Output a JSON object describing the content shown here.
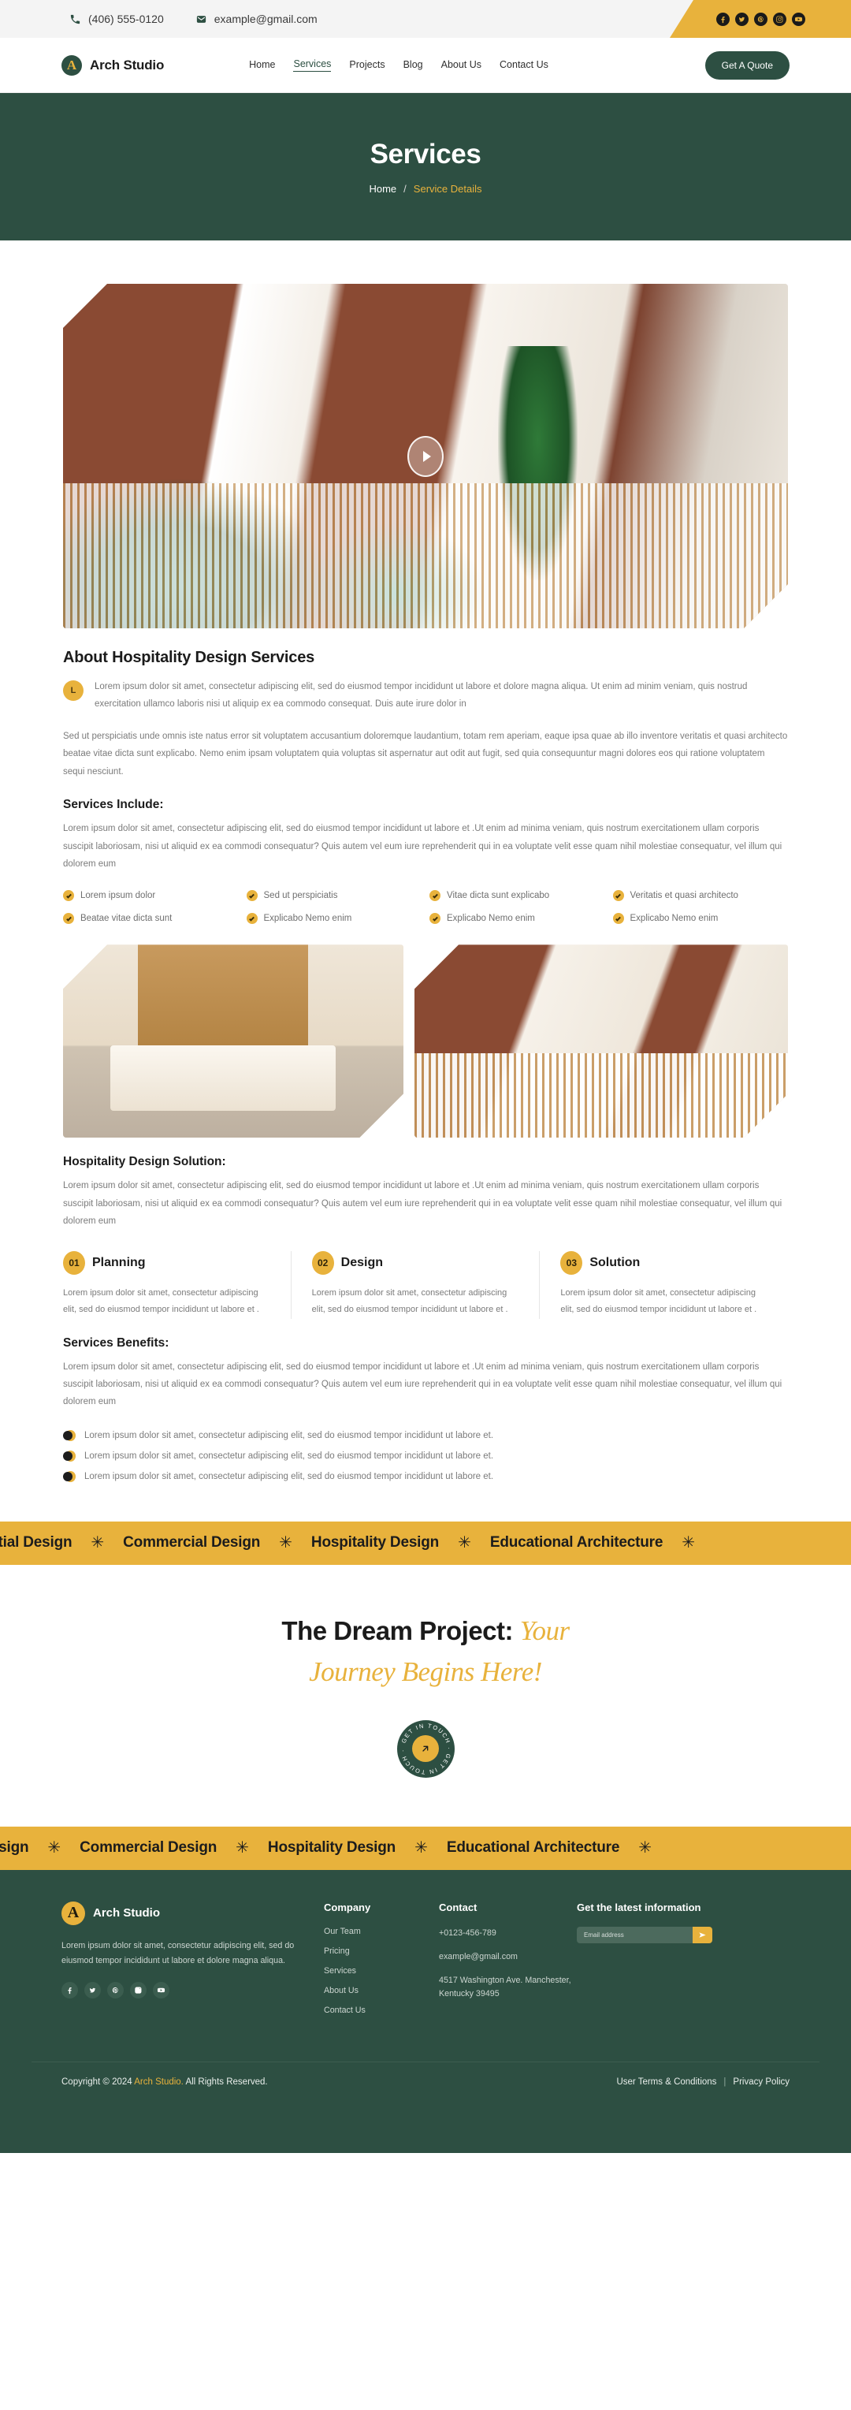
{
  "topbar": {
    "phone": "(406) 555-0120",
    "email": "example@gmail.com",
    "socials": [
      "facebook-icon",
      "twitter-icon",
      "pinterest-icon",
      "instagram-icon",
      "youtube-icon"
    ]
  },
  "nav": {
    "brand_letter": "A",
    "brand_name": "Arch Studio",
    "links": [
      {
        "label": "Home",
        "active": false
      },
      {
        "label": "Services",
        "active": true
      },
      {
        "label": "Projects",
        "active": false
      },
      {
        "label": "Blog",
        "active": false
      },
      {
        "label": "About Us",
        "active": false
      },
      {
        "label": "Contact Us",
        "active": false
      }
    ],
    "cta_label": "Get A Quote"
  },
  "hero": {
    "title": "Services",
    "breadcrumb_home": "Home",
    "breadcrumb_sep": "/",
    "breadcrumb_current": "Service Details"
  },
  "content": {
    "about_heading": "About Hospitality Design Services",
    "dropcap": "L",
    "about_p1": "Lorem ipsum dolor sit amet, consectetur adipiscing elit, sed do eiusmod tempor incididunt ut labore et dolore magna aliqua. Ut enim ad minim veniam, quis nostrud exercitation ullamco laboris nisi ut aliquip ex ea commodo consequat. Duis aute irure dolor in",
    "about_p2": "Sed ut perspiciatis unde omnis iste natus error sit voluptatem accusantium doloremque laudantium, totam rem aperiam, eaque ipsa quae ab illo inventore veritatis et quasi architecto beatae vitae dicta sunt explicabo. Nemo enim ipsam voluptatem quia voluptas sit aspernatur aut odit aut fugit, sed quia consequuntur magni dolores eos qui ratione voluptatem sequi nesciunt.",
    "include_heading": "Services Include:",
    "include_paragraph": "Lorem ipsum dolor sit amet, consectetur adipiscing elit, sed do eiusmod tempor incididunt ut labore et .Ut enim ad minima veniam, quis nostrum exercitationem ullam corporis suscipit laboriosam, nisi ut aliquid ex ea commodi consequatur? Quis autem vel eum iure reprehenderit qui in ea voluptate velit esse quam nihil molestiae consequatur, vel illum qui dolorem eum",
    "include_items": [
      "Lorem ipsum dolor",
      "Sed ut perspiciatis",
      "Vitae dicta sunt explicabo",
      "Veritatis et quasi architecto",
      "Beatae vitae dicta sunt",
      "Explicabo Nemo enim",
      "Explicabo Nemo enim",
      "Explicabo Nemo enim"
    ],
    "solution_heading": "Hospitality Design Solution:",
    "solution_paragraph": "Lorem ipsum dolor sit amet, consectetur adipiscing elit, sed do eiusmod tempor incididunt ut labore et .Ut enim ad minima veniam, quis nostrum exercitationem ullam corporis suscipit laboriosam, nisi ut aliquid ex ea commodi consequatur? Quis autem vel eum iure reprehenderit qui in ea voluptate velit esse quam nihil molestiae consequatur, vel illum qui dolorem eum",
    "steps": [
      {
        "num": "01",
        "title": "Planning",
        "text": "Lorem ipsum dolor sit amet, consectetur adipiscing elit, sed do eiusmod tempor incididunt ut labore et ."
      },
      {
        "num": "02",
        "title": "Design",
        "text": "Lorem ipsum dolor sit amet, consectetur adipiscing elit, sed do eiusmod tempor incididunt ut labore et ."
      },
      {
        "num": "03",
        "title": "Solution",
        "text": "Lorem ipsum dolor sit amet, consectetur adipiscing elit, sed do eiusmod tempor incididunt ut labore et ."
      }
    ],
    "benefits_heading": "Services Benefits:",
    "benefits_paragraph": "Lorem ipsum dolor sit amet, consectetur adipiscing elit, sed do eiusmod tempor incididunt ut labore et .Ut enim ad minima veniam, quis nostrum exercitationem ullam corporis suscipit laboriosam, nisi ut aliquid ex ea commodi consequatur? Quis autem vel eum iure reprehenderit qui in ea voluptate velit esse quam nihil molestiae consequatur, vel illum qui dolorem eum",
    "benefit_items": [
      "Lorem ipsum dolor sit amet, consectetur adipiscing elit, sed do eiusmod tempor incididunt ut labore et.",
      "Lorem ipsum dolor sit amet, consectetur adipiscing elit, sed do eiusmod tempor incididunt ut labore et.",
      "Lorem ipsum dolor sit amet, consectetur adipiscing elit, sed do eiusmod tempor incididunt ut labore et."
    ]
  },
  "marquee": {
    "separator": "✳",
    "items": [
      "Residential Design",
      "Commercial Design",
      "Hospitality Design",
      "Educational Architecture"
    ]
  },
  "cta": {
    "title_plain": "The Dream Project: ",
    "title_accent_1": "Your",
    "title_accent_2": "Journey Begins Here!",
    "badge_text": "GET IN TOUCH · GET IN TOUCH · ",
    "badge_icon": "arrow-up-right-icon"
  },
  "footer": {
    "brand_letter": "A",
    "brand_name": "Arch Studio",
    "description": "Lorem ipsum dolor sit amet, consectetur adipiscing elit, sed do eiusmod tempor incididunt ut labore et dolore magna aliqua.",
    "socials": [
      "facebook-icon",
      "twitter-icon",
      "pinterest-icon",
      "instagram-icon",
      "youtube-icon"
    ],
    "company_heading": "Company",
    "company_links": [
      "Our Team",
      "Pricing",
      "Services",
      "About Us",
      "Contact Us"
    ],
    "contact_heading": "Contact",
    "contact_phone": "+0123-456-789",
    "contact_email": "example@gmail.com",
    "contact_address": "4517 Washington Ave. Manchester, Kentucky 39495",
    "newsletter_heading": "Get the latest information",
    "newsletter_placeholder": "Email address",
    "newsletter_value": "",
    "copyright_pre": "Copyright © 2024 ",
    "copyright_brand": "Arch Studio.",
    "copyright_post": " All Rights Reserved.",
    "terms": "User Terms & Conditions",
    "legal_sep": "|",
    "privacy": "Privacy Policy"
  },
  "colors": {
    "green": "#2d4f42",
    "yellow": "#e8b23c",
    "dark": "#1b1b1b",
    "muted": "#7b7b7b"
  }
}
